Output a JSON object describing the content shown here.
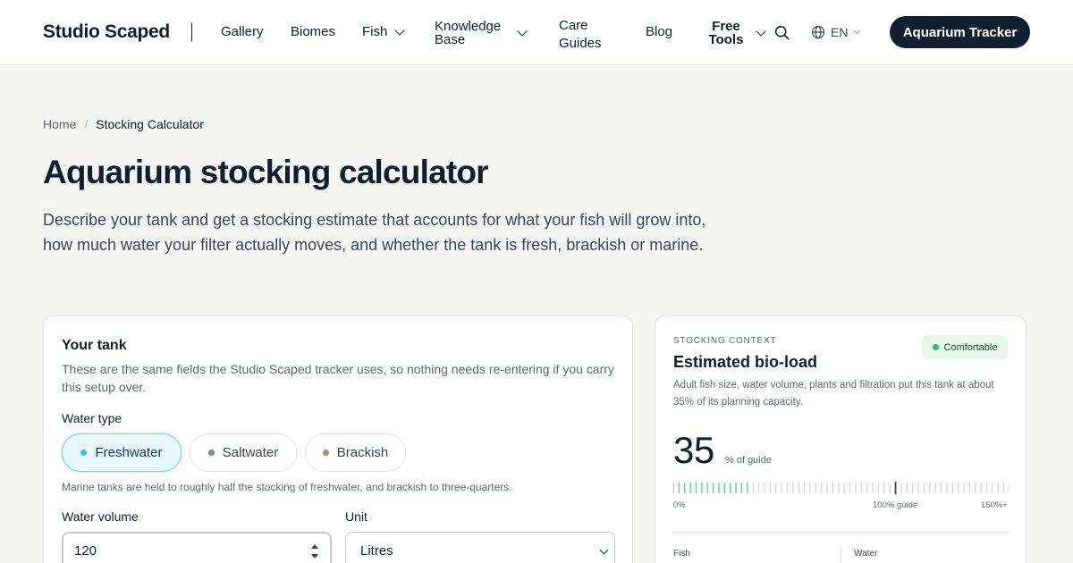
{
  "header": {
    "brand": "Studio Scaped",
    "nav": [
      {
        "label": "Gallery",
        "dropdown": false
      },
      {
        "label": "Biomes",
        "dropdown": false
      },
      {
        "label": "Fish",
        "dropdown": true
      },
      {
        "label": "Knowledge Base",
        "dropdown": true
      },
      {
        "label": "Care Guides",
        "dropdown": false
      },
      {
        "label": "Blog",
        "dropdown": false
      },
      {
        "label": "Free Tools",
        "dropdown": true
      }
    ],
    "language": "EN",
    "cta_label": "Aquarium Tracker"
  },
  "breadcrumb": {
    "home": "Home",
    "separator": "/",
    "current": "Stocking Calculator"
  },
  "page": {
    "title": "Aquarium stocking calculator",
    "intro": "Describe your tank and get a stocking estimate that accounts for what your fish will grow into, how much water your filter actually moves, and whether the tank is fresh, brackish or marine."
  },
  "tank_card": {
    "title": "Your tank",
    "subtitle": "These are the same fields the Studio Scaped tracker uses, so nothing needs re-entering if you carry this setup over.",
    "water_type_label": "Water type",
    "water_types": [
      {
        "label": "Freshwater",
        "color": "#38bdf8",
        "active": true
      },
      {
        "label": "Saltwater",
        "color": "#6b8ba4",
        "active": false
      },
      {
        "label": "Brackish",
        "color": "#b08a6a",
        "active": false
      }
    ],
    "water_type_hint": "Marine tanks are held to roughly half the stocking of freshwater, and brackish to three-quarters.",
    "volume_label": "Water volume",
    "volume_value": "120",
    "unit_label": "Unit",
    "unit_value": "Litres"
  },
  "context_card": {
    "eyebrow": "STOCKING CONTEXT",
    "status": "Comfortable",
    "title": "Estimated bio-load",
    "description": "Adult fish size, water volume, plants and filtration put this tank at about 35% of its planning capacity.",
    "percent": "35",
    "percent_unit": "% of guide",
    "gauge": {
      "value_percent": 35,
      "max_percent": 150,
      "guide_percent": 100,
      "active_color": "#4ade80",
      "inactive_color": "#d6d9dc",
      "guide_color": "#3b4754"
    },
    "scale_labels": {
      "min": "0%",
      "guide": "100% guide",
      "max": "150%+"
    },
    "stats": [
      {
        "label": "Fish"
      },
      {
        "label": "Water"
      }
    ]
  }
}
